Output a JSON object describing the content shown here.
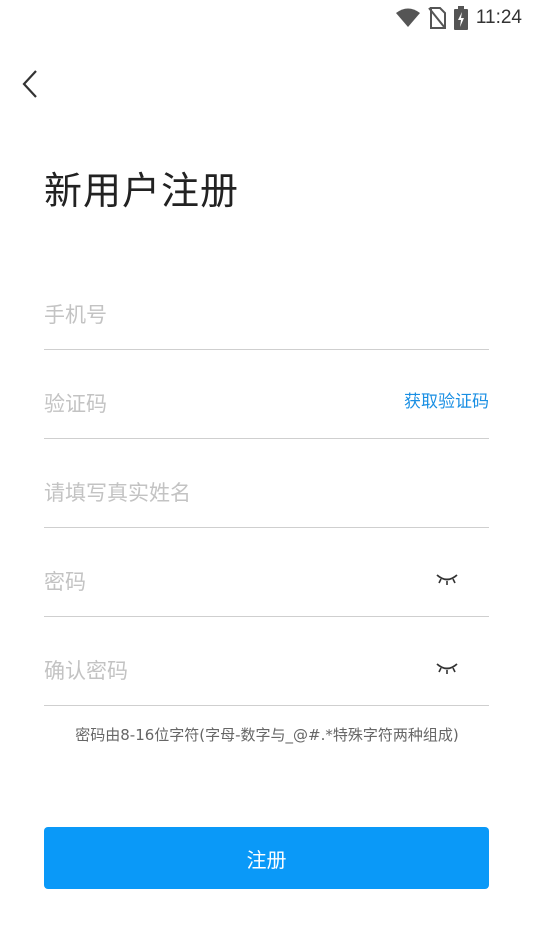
{
  "status_bar": {
    "time": "11:24",
    "icons": [
      "wifi-icon",
      "no-sim-icon",
      "battery-charging-icon"
    ]
  },
  "page": {
    "title": "新用户注册"
  },
  "form": {
    "phone": {
      "placeholder": "手机号",
      "value": ""
    },
    "code": {
      "placeholder": "验证码",
      "value": "",
      "action_label": "获取验证码"
    },
    "real_name": {
      "placeholder": "请填写真实姓名",
      "value": ""
    },
    "password": {
      "placeholder": "密码",
      "value": "",
      "toggle_icon": "eye-closed-icon"
    },
    "confirm_password": {
      "placeholder": "确认密码",
      "value": "",
      "toggle_icon": "eye-closed-icon"
    }
  },
  "hint": "密码由8-16位字符(字母-数字与_@#.*特殊字符两种组成)",
  "submit": {
    "label": "注册"
  },
  "colors": {
    "accent": "#0a99f8",
    "link": "#1a8fe3",
    "divider": "#cfcfcf",
    "placeholder": "#c3c3c3"
  }
}
